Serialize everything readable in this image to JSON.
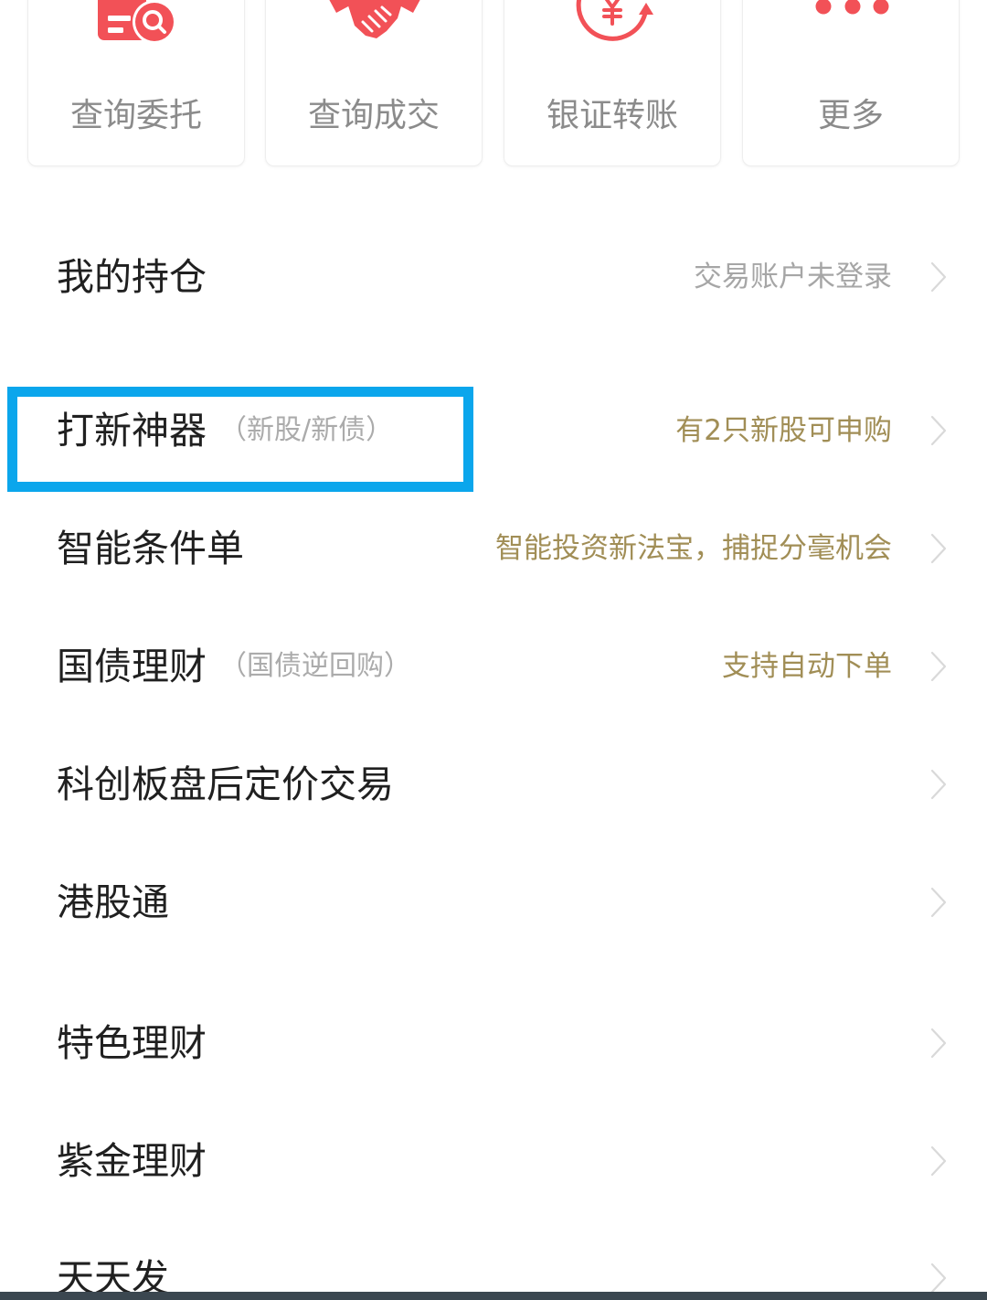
{
  "quick_actions": [
    {
      "label": "查询委托",
      "icon": "search-order-icon"
    },
    {
      "label": "查询成交",
      "icon": "handshake-icon"
    },
    {
      "label": "银证转账",
      "icon": "yen-transfer-icon"
    },
    {
      "label": "更多",
      "icon": "more-dots-icon"
    }
  ],
  "menu": [
    {
      "title": "我的持仓",
      "hint": "交易账户未登录"
    },
    {
      "title": "打新神器",
      "subtitle": "（新股/新债）",
      "hint": "有2只新股可申购"
    },
    {
      "title": "智能条件单",
      "hint": "智能投资新法宝，捕捉分毫机会"
    },
    {
      "title": "国债理财",
      "subtitle": "（国债逆回购）",
      "hint": "支持自动下单"
    },
    {
      "title": "科创板盘后定价交易"
    },
    {
      "title": "港股通"
    },
    {
      "title": "特色理财"
    },
    {
      "title": "紫金理财"
    },
    {
      "title": "天天发"
    }
  ],
  "colors": {
    "icon_accent": "#f25157",
    "hint_promo": "#a18e56",
    "hint_muted": "#a6a6a6",
    "highlight": "#0ba6ec"
  }
}
